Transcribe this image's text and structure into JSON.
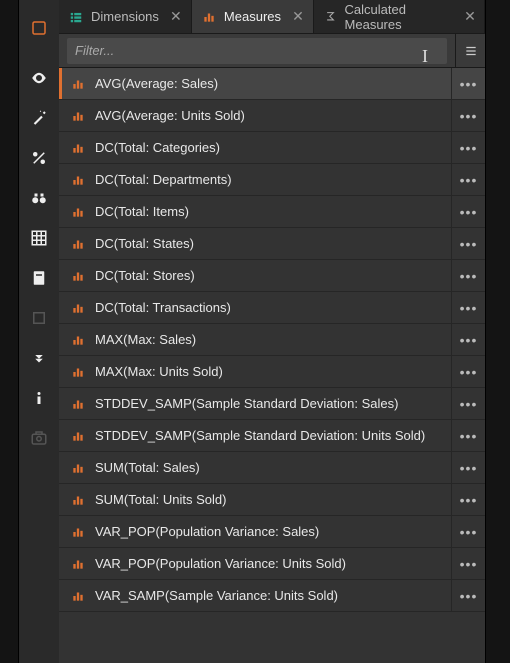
{
  "tabs": [
    {
      "label": "Dimensions",
      "iconColor": "teal",
      "active": false
    },
    {
      "label": "Measures",
      "iconColor": "orange",
      "active": true
    },
    {
      "label": "Calculated Measures",
      "iconColor": "gray",
      "active": false
    }
  ],
  "filter": {
    "placeholder": "Filter..."
  },
  "measures": [
    {
      "label": "AVG(Average: Sales)",
      "selected": true
    },
    {
      "label": "AVG(Average: Units Sold)",
      "selected": false
    },
    {
      "label": "DC(Total: Categories)",
      "selected": false
    },
    {
      "label": "DC(Total: Departments)",
      "selected": false
    },
    {
      "label": "DC(Total: Items)",
      "selected": false
    },
    {
      "label": "DC(Total: States)",
      "selected": false
    },
    {
      "label": "DC(Total: Stores)",
      "selected": false
    },
    {
      "label": "DC(Total: Transactions)",
      "selected": false
    },
    {
      "label": "MAX(Max: Sales)",
      "selected": false
    },
    {
      "label": "MAX(Max: Units Sold)",
      "selected": false
    },
    {
      "label": "STDDEV_SAMP(Sample Standard Deviation: Sales)",
      "selected": false
    },
    {
      "label": "STDDEV_SAMP(Sample Standard Deviation: Units Sold)",
      "selected": false
    },
    {
      "label": "SUM(Total: Sales)",
      "selected": false
    },
    {
      "label": "SUM(Total: Units Sold)",
      "selected": false
    },
    {
      "label": "VAR_POP(Population Variance: Sales)",
      "selected": false
    },
    {
      "label": "VAR_POP(Population Variance: Units Sold)",
      "selected": false
    },
    {
      "label": "VAR_SAMP(Sample Variance: Units Sold)",
      "selected": false
    }
  ],
  "menu_glyph": "•••",
  "close_glyph": "✕"
}
